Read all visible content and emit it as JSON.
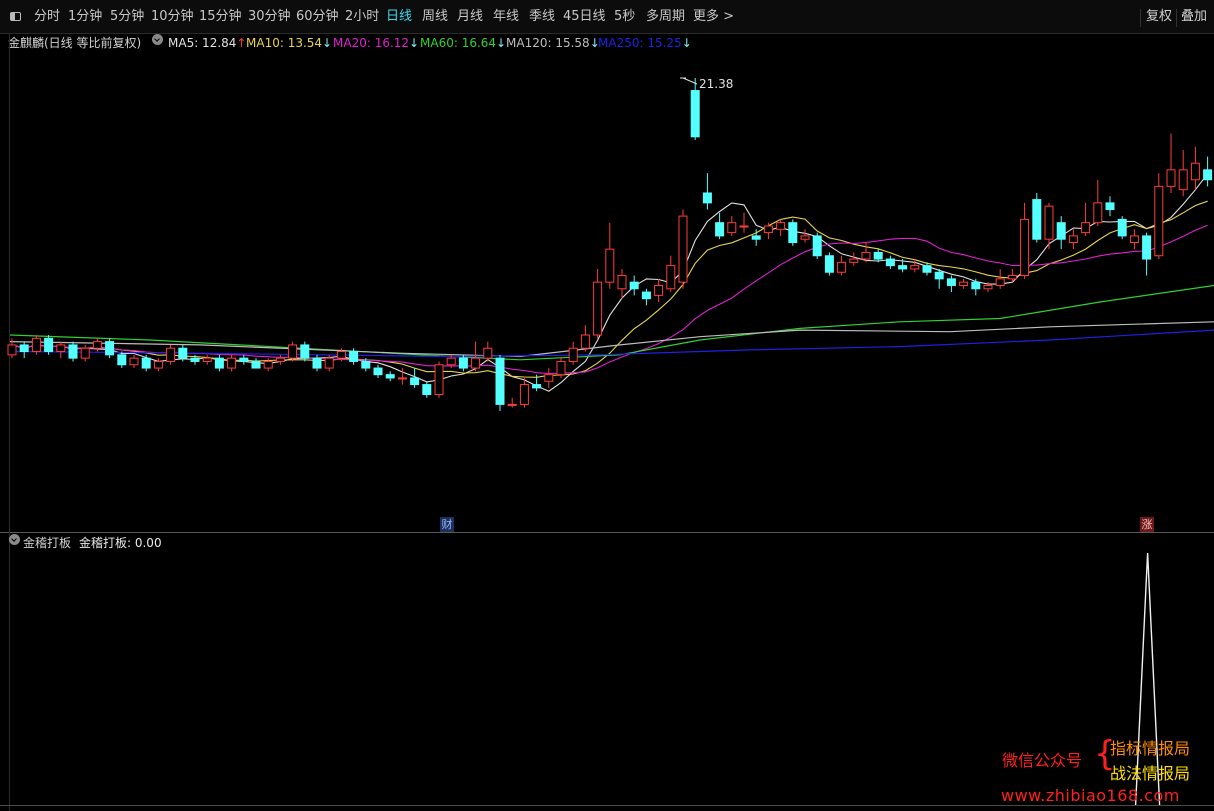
{
  "toolbar": {
    "periods": [
      {
        "label": "分时",
        "active": false
      },
      {
        "label": "1分钟",
        "active": false
      },
      {
        "label": "5分钟",
        "active": false
      },
      {
        "label": "10分钟",
        "active": false
      },
      {
        "label": "15分钟",
        "active": false
      },
      {
        "label": "30分钟",
        "active": false
      },
      {
        "label": "60分钟",
        "active": false
      },
      {
        "label": "2小时",
        "active": false
      },
      {
        "label": "日线",
        "active": true
      },
      {
        "label": "周线",
        "active": false
      },
      {
        "label": "月线",
        "active": false
      },
      {
        "label": "年线",
        "active": false
      },
      {
        "label": "季线",
        "active": false
      },
      {
        "label": "45日线",
        "active": false
      },
      {
        "label": "5秒",
        "active": false
      },
      {
        "label": "多周期",
        "active": false
      },
      {
        "label": "更多 >",
        "active": false
      }
    ],
    "right_buttons": [
      "复权",
      "叠加"
    ]
  },
  "main_info": {
    "title": "金麒麟(日线 等比前复权)",
    "indicators": [
      {
        "label": "MA5: 12.84",
        "arrow": "↑",
        "color": "#e0e0e0",
        "arrow_color": "#ff3b3b"
      },
      {
        "label": "MA10: 13.54",
        "arrow": "↓",
        "color": "#e8d34a",
        "arrow_color": "#7ef0ff"
      },
      {
        "label": "MA20: 16.12",
        "arrow": "↓",
        "color": "#e020d0",
        "arrow_color": "#7ef0ff"
      },
      {
        "label": "MA60: 16.64",
        "arrow": "↓",
        "color": "#30d030",
        "arrow_color": "#7ef0ff"
      },
      {
        "label": "MA120: 15.58",
        "arrow": "↓",
        "color": "#bdbdbd",
        "arrow_color": "#7ef0ff"
      },
      {
        "label": "MA250: 15.25",
        "arrow": "↓",
        "color": "#2020e0",
        "arrow_color": "#7ef0ff"
      }
    ]
  },
  "high_marker": "21.38",
  "badges": {
    "cai": "财",
    "zhang": "涨"
  },
  "sub_info": {
    "title": "金稽打板",
    "indicator": "金稽打板: 0.00"
  },
  "watermark": {
    "wechat": "微信公众号",
    "brace": "{",
    "line1": "指标情报局",
    "line2": "战法情报局",
    "url": "www.zhibiao168.com"
  },
  "colors": {
    "up": "#ff3b3b",
    "down": "#54ffff",
    "ma5": "#e0e0e0",
    "ma10": "#e8d34a",
    "ma20": "#e020d0",
    "ma60": "#30d030",
    "ma120": "#bdbdbd",
    "ma250": "#2020e0"
  },
  "chart_data": {
    "type": "candlestick",
    "candles": [
      {
        "o": 13.0,
        "c": 13.3,
        "h": 13.5,
        "l": 12.9
      },
      {
        "o": 13.3,
        "c": 13.1,
        "h": 13.4,
        "l": 12.9
      },
      {
        "o": 13.1,
        "c": 13.5,
        "h": 13.6,
        "l": 13.0
      },
      {
        "o": 13.5,
        "c": 13.1,
        "h": 13.6,
        "l": 13.0
      },
      {
        "o": 13.1,
        "c": 13.3,
        "h": 13.4,
        "l": 12.9
      },
      {
        "o": 13.3,
        "c": 12.9,
        "h": 13.4,
        "l": 12.8
      },
      {
        "o": 12.9,
        "c": 13.2,
        "h": 13.3,
        "l": 12.8
      },
      {
        "o": 13.2,
        "c": 13.4,
        "h": 13.5,
        "l": 13.1
      },
      {
        "o": 13.4,
        "c": 13.0,
        "h": 13.5,
        "l": 12.9
      },
      {
        "o": 13.0,
        "c": 12.7,
        "h": 13.1,
        "l": 12.6
      },
      {
        "o": 12.7,
        "c": 12.9,
        "h": 13.0,
        "l": 12.6
      },
      {
        "o": 12.9,
        "c": 12.6,
        "h": 13.0,
        "l": 12.5
      },
      {
        "o": 12.6,
        "c": 12.8,
        "h": 12.9,
        "l": 12.5
      },
      {
        "o": 12.8,
        "c": 13.2,
        "h": 13.3,
        "l": 12.7
      },
      {
        "o": 13.2,
        "c": 12.9,
        "h": 13.3,
        "l": 12.8
      },
      {
        "o": 12.9,
        "c": 12.8,
        "h": 13.0,
        "l": 12.7
      },
      {
        "o": 12.8,
        "c": 12.9,
        "h": 13.0,
        "l": 12.7
      },
      {
        "o": 12.9,
        "c": 12.6,
        "h": 13.0,
        "l": 12.5
      },
      {
        "o": 12.6,
        "c": 12.9,
        "h": 13.0,
        "l": 12.5
      },
      {
        "o": 12.9,
        "c": 12.8,
        "h": 13.0,
        "l": 12.7
      },
      {
        "o": 12.8,
        "c": 12.6,
        "h": 12.9,
        "l": 12.6
      },
      {
        "o": 12.6,
        "c": 12.8,
        "h": 12.9,
        "l": 12.5
      },
      {
        "o": 12.8,
        "c": 12.9,
        "h": 13.0,
        "l": 12.7
      },
      {
        "o": 12.9,
        "c": 13.3,
        "h": 13.4,
        "l": 12.8
      },
      {
        "o": 13.3,
        "c": 12.9,
        "h": 13.4,
        "l": 12.8
      },
      {
        "o": 12.9,
        "c": 12.6,
        "h": 13.0,
        "l": 12.5
      },
      {
        "o": 12.6,
        "c": 12.9,
        "h": 13.0,
        "l": 12.5
      },
      {
        "o": 12.9,
        "c": 13.1,
        "h": 13.2,
        "l": 12.8
      },
      {
        "o": 13.1,
        "c": 12.8,
        "h": 13.2,
        "l": 12.7
      },
      {
        "o": 12.8,
        "c": 12.6,
        "h": 12.9,
        "l": 12.5
      },
      {
        "o": 12.6,
        "c": 12.4,
        "h": 12.7,
        "l": 12.3
      },
      {
        "o": 12.4,
        "c": 12.3,
        "h": 12.5,
        "l": 12.2
      },
      {
        "o": 12.3,
        "c": 12.3,
        "h": 12.6,
        "l": 12.1
      },
      {
        "o": 12.3,
        "c": 12.1,
        "h": 12.6,
        "l": 12.0
      },
      {
        "o": 12.1,
        "c": 11.8,
        "h": 12.2,
        "l": 11.7
      },
      {
        "o": 11.8,
        "c": 12.7,
        "h": 12.8,
        "l": 11.7
      },
      {
        "o": 12.7,
        "c": 12.9,
        "h": 13.0,
        "l": 12.6
      },
      {
        "o": 12.9,
        "c": 12.6,
        "h": 13.0,
        "l": 12.5
      },
      {
        "o": 12.6,
        "c": 12.9,
        "h": 13.4,
        "l": 12.5
      },
      {
        "o": 12.9,
        "c": 13.2,
        "h": 13.4,
        "l": 12.8
      },
      {
        "o": 12.9,
        "c": 11.5,
        "h": 13.0,
        "l": 11.3
      },
      {
        "o": 11.5,
        "c": 11.5,
        "h": 11.7,
        "l": 11.4
      },
      {
        "o": 11.5,
        "c": 12.1,
        "h": 12.3,
        "l": 11.4
      },
      {
        "o": 12.1,
        "c": 12.0,
        "h": 12.4,
        "l": 11.9
      },
      {
        "o": 12.2,
        "c": 12.4,
        "h": 12.6,
        "l": 12.0
      },
      {
        "o": 12.4,
        "c": 12.8,
        "h": 12.9,
        "l": 12.3
      },
      {
        "o": 12.8,
        "c": 13.2,
        "h": 13.4,
        "l": 12.7
      },
      {
        "o": 13.2,
        "c": 13.6,
        "h": 13.9,
        "l": 13.1
      },
      {
        "o": 13.6,
        "c": 15.2,
        "h": 15.6,
        "l": 13.5
      },
      {
        "o": 15.2,
        "c": 16.2,
        "h": 17.0,
        "l": 15.0
      },
      {
        "o": 15.0,
        "c": 15.4,
        "h": 15.6,
        "l": 14.7
      },
      {
        "o": 15.2,
        "c": 15.0,
        "h": 15.4,
        "l": 14.8
      },
      {
        "o": 14.9,
        "c": 14.7,
        "h": 15.0,
        "l": 14.5
      },
      {
        "o": 14.8,
        "c": 15.1,
        "h": 15.3,
        "l": 14.6
      },
      {
        "o": 15.0,
        "c": 15.7,
        "h": 16.0,
        "l": 14.9
      },
      {
        "o": 15.2,
        "c": 17.2,
        "h": 17.4,
        "l": 15.0
      },
      {
        "o": 21.0,
        "c": 19.6,
        "h": 21.38,
        "l": 19.5
      },
      {
        "o": 17.9,
        "c": 17.6,
        "h": 18.5,
        "l": 17.4
      },
      {
        "o": 17.0,
        "c": 16.6,
        "h": 17.3,
        "l": 16.5
      },
      {
        "o": 16.7,
        "c": 17.0,
        "h": 17.2,
        "l": 16.6
      },
      {
        "o": 16.9,
        "c": 16.9,
        "h": 17.3,
        "l": 16.7
      },
      {
        "o": 16.6,
        "c": 16.5,
        "h": 16.8,
        "l": 16.3
      },
      {
        "o": 16.7,
        "c": 16.9,
        "h": 17.0,
        "l": 16.5
      },
      {
        "o": 16.8,
        "c": 17.0,
        "h": 17.1,
        "l": 16.6
      },
      {
        "o": 17.0,
        "c": 16.4,
        "h": 17.1,
        "l": 16.3
      },
      {
        "o": 16.5,
        "c": 16.6,
        "h": 16.8,
        "l": 16.4
      },
      {
        "o": 16.6,
        "c": 16.0,
        "h": 16.7,
        "l": 15.9
      },
      {
        "o": 16.0,
        "c": 15.5,
        "h": 16.1,
        "l": 15.4
      },
      {
        "o": 15.5,
        "c": 15.8,
        "h": 16.0,
        "l": 15.4
      },
      {
        "o": 15.8,
        "c": 15.9,
        "h": 16.1,
        "l": 15.7
      },
      {
        "o": 15.9,
        "c": 16.1,
        "h": 16.4,
        "l": 15.8
      },
      {
        "o": 16.1,
        "c": 15.9,
        "h": 16.2,
        "l": 15.8
      },
      {
        "o": 15.9,
        "c": 15.7,
        "h": 16.0,
        "l": 15.6
      },
      {
        "o": 15.7,
        "c": 15.6,
        "h": 15.9,
        "l": 15.5
      },
      {
        "o": 15.6,
        "c": 15.7,
        "h": 15.9,
        "l": 15.5
      },
      {
        "o": 15.7,
        "c": 15.5,
        "h": 15.8,
        "l": 15.4
      },
      {
        "o": 15.5,
        "c": 15.3,
        "h": 15.6,
        "l": 15.0
      },
      {
        "o": 15.3,
        "c": 15.1,
        "h": 15.4,
        "l": 14.9
      },
      {
        "o": 15.1,
        "c": 15.2,
        "h": 15.3,
        "l": 15.0
      },
      {
        "o": 15.2,
        "c": 15.0,
        "h": 15.3,
        "l": 14.8
      },
      {
        "o": 15.0,
        "c": 15.1,
        "h": 15.2,
        "l": 14.9
      },
      {
        "o": 15.1,
        "c": 15.3,
        "h": 15.6,
        "l": 15.0
      },
      {
        "o": 15.3,
        "c": 15.4,
        "h": 15.6,
        "l": 15.2
      },
      {
        "o": 15.4,
        "c": 17.1,
        "h": 17.6,
        "l": 15.3
      },
      {
        "o": 17.7,
        "c": 16.5,
        "h": 17.9,
        "l": 16.4
      },
      {
        "o": 16.5,
        "c": 17.5,
        "h": 17.6,
        "l": 16.2
      },
      {
        "o": 17.0,
        "c": 16.5,
        "h": 17.2,
        "l": 16.2
      },
      {
        "o": 16.4,
        "c": 16.6,
        "h": 16.8,
        "l": 16.2
      },
      {
        "o": 16.7,
        "c": 17.0,
        "h": 17.6,
        "l": 16.6
      },
      {
        "o": 17.0,
        "c": 17.6,
        "h": 18.3,
        "l": 16.9
      },
      {
        "o": 17.6,
        "c": 17.4,
        "h": 17.8,
        "l": 17.2
      },
      {
        "o": 17.1,
        "c": 16.6,
        "h": 17.2,
        "l": 16.5
      },
      {
        "o": 16.4,
        "c": 16.6,
        "h": 16.8,
        "l": 16.2
      },
      {
        "o": 16.6,
        "c": 15.9,
        "h": 16.7,
        "l": 15.4
      },
      {
        "o": 16.0,
        "c": 18.1,
        "h": 18.5,
        "l": 15.9
      },
      {
        "o": 18.1,
        "c": 18.6,
        "h": 19.7,
        "l": 17.9
      },
      {
        "o": 18.0,
        "c": 18.6,
        "h": 19.2,
        "l": 17.8
      },
      {
        "o": 18.3,
        "c": 18.8,
        "h": 19.3,
        "l": 18.0
      },
      {
        "o": 18.6,
        "c": 18.3,
        "h": 19.0,
        "l": 18.1
      }
    ],
    "signal": {
      "series": "金稽打板",
      "current": 0.0,
      "peak": 1.0
    }
  }
}
